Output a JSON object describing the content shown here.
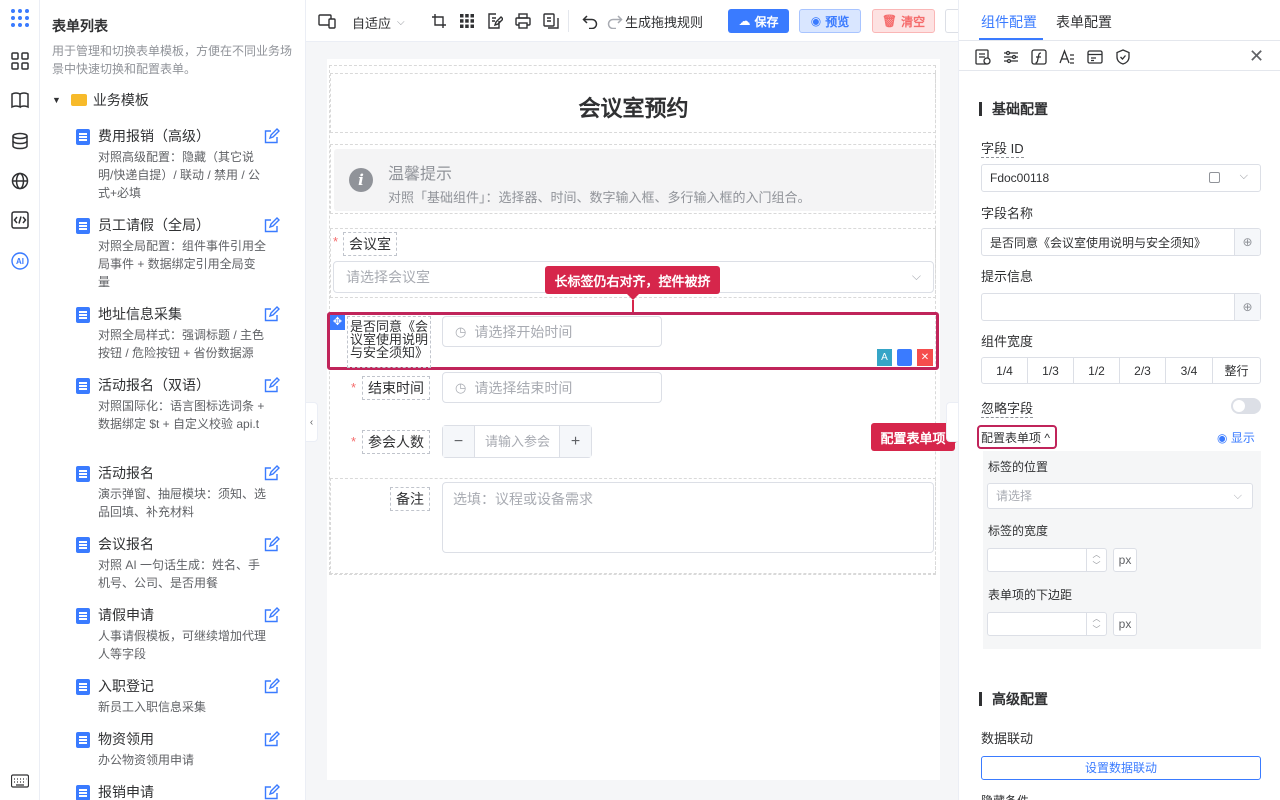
{
  "left_panel": {
    "title": "表单列表",
    "description": "用于管理和切换表单模板，方便在不同业务场景中快速切换和配置表单。",
    "folder": "业务模板",
    "templates": [
      {
        "name": "费用报销（高级）",
        "desc": "对照高级配置：隐藏（其它说明/快递自提）/ 联动 / 禁用 / 公式+必填"
      },
      {
        "name": "员工请假（全局）",
        "desc": "对照全局配置：组件事件引用全局事件 + 数据绑定引用全局变量"
      },
      {
        "name": "地址信息采集",
        "desc": "对照全局样式：强调标题 / 主色按钮 / 危险按钮 + 省份数据源"
      },
      {
        "name": "活动报名（双语）",
        "desc": "对照国际化：语言图标选词条 + 数据绑定 $t + 自定义校验 api.t"
      },
      {
        "name": "活动报名",
        "desc": "演示弹窗、抽屉模块：须知、选品回填、补充材料"
      },
      {
        "name": "会议报名",
        "desc": "对照 AI 一句话生成：姓名、手机号、公司、是否用餐"
      },
      {
        "name": "请假申请",
        "desc": "人事请假模板，可继续增加代理人等字段"
      },
      {
        "name": "入职登记",
        "desc": "新员工入职信息采集"
      },
      {
        "name": "物资领用",
        "desc": "办公物资领用申请"
      },
      {
        "name": "报销申请",
        "desc": ""
      }
    ]
  },
  "toolbar": {
    "adaptive": "自适应",
    "rules": "生成拖拽规则",
    "save": "保存",
    "preview": "预览",
    "clear": "清空"
  },
  "form": {
    "title": "会议室预约",
    "tip_title": "温馨提示",
    "tip_body": "对照「基础组件」：选择器、时间、数字输入框、多行输入框的入门组合。",
    "room_label": "会议室",
    "room_placeholder": "请选择会议室",
    "agree_label": "是否同意《会议室使用说明与安全须知》",
    "start_placeholder": "请选择开始时间",
    "end_label": "结束时间",
    "end_placeholder": "请选择结束时间",
    "count_label": "参会人数",
    "count_placeholder": "请输入参会",
    "remark_label": "备注",
    "remark_placeholder": "选填：议程或设备需求",
    "callout_top": "长标签仍右对齐，控件被挤",
    "callout_right": "配置表单项"
  },
  "right_panel": {
    "tabs": [
      "组件配置",
      "表单配置"
    ],
    "basic_title": "基础配置",
    "field_id_label": "字段 ID",
    "field_id_value": "Fdoc00118",
    "field_name_label": "字段名称",
    "field_name_value": "是否同意《会议室使用说明与安全须知》",
    "tip_label": "提示信息",
    "width_label": "组件宽度",
    "widths": [
      "1/4",
      "1/3",
      "1/2",
      "2/3",
      "3/4",
      "整行"
    ],
    "ignore_label": "忽略字段",
    "formitem_label": "配置表单项",
    "show_label": "显示",
    "label_pos": "标签的位置",
    "label_pos_placeholder": "请选择",
    "label_width": "标签的宽度",
    "unit": "px",
    "bottom_margin": "表单项的下边距",
    "advanced_title": "高级配置",
    "linkage_label": "数据联动",
    "linkage_button": "设置数据联动",
    "hidden_label": "隐藏条件"
  },
  "colors": {
    "primary": "#3a7bff",
    "accent": "#d6264b",
    "danger": "#f56c6c"
  }
}
